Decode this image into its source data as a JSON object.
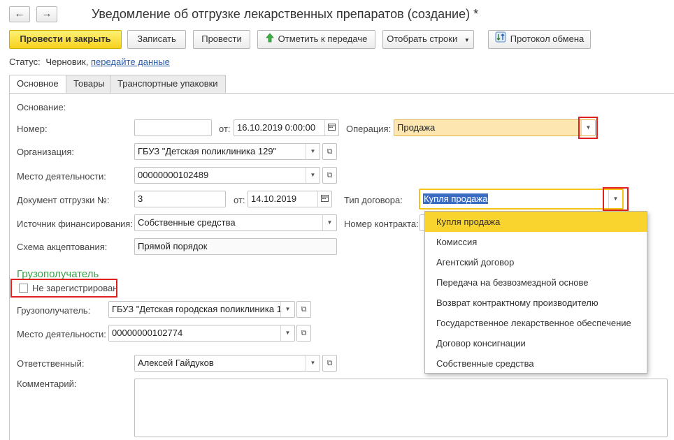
{
  "window": {
    "title": "Уведомление об отгрузке лекарственных препаратов (создание) *",
    "nav": {
      "back": "←",
      "forward": "→"
    }
  },
  "toolbar": {
    "post_close": "Провести и закрыть",
    "save": "Записать",
    "post": "Провести",
    "mark_transfer": "Отметить к передаче",
    "select_rows": "Отобрать строки",
    "exchange_log": "Протокол обмена"
  },
  "status": {
    "label": "Статус:",
    "value": "Черновик,",
    "link": "передайте данные"
  },
  "tabs": [
    "Основное",
    "Товары",
    "Транспортные упаковки"
  ],
  "form": {
    "basis_label": "Основание:",
    "number_label": "Номер:",
    "number_value": "",
    "from_label": "от:",
    "date_value": "16.10.2019  0:00:00",
    "operation_label": "Операция:",
    "operation_value": "Продажа",
    "org_label": "Организация:",
    "org_value": "ГБУЗ \"Детская  поликлиника 129\"",
    "place_label": "Место деятельности:",
    "place_value": "00000000102489",
    "ship_doc_label": "Документ отгрузки №:",
    "ship_doc_value": "3",
    "ship_from_label": "от:",
    "ship_date_value": "14.10.2019",
    "contract_type_label": "Тип договора:",
    "contract_type_value": "Купля продажа",
    "funding_label": "Источник финансирования:",
    "funding_value": "Собственные средства",
    "contract_no_label": "Номер контракта:",
    "scheme_label": "Схема акцептования:",
    "scheme_value": "Прямой порядок",
    "consignee_section": "Грузополучатель",
    "not_registered_label": "Не зарегистрирован",
    "consignee_label": "Грузополучатель:",
    "consignee_value": "ГБУЗ \"Детская городская поликлиника 1",
    "consignee_place_label": "Место деятельности:",
    "consignee_place_value": "00000000102774",
    "responsible_label": "Ответственный:",
    "responsible_value": "Алексей Гайдуков",
    "comment_label": "Комментарий:"
  },
  "dropdown": {
    "items": [
      "Купля продажа",
      "Комиссия",
      "Агентский договор",
      "Передача на безвозмездной основе",
      "Возврат контрактному производителю",
      "Государственное лекарственное обеспечение",
      "Договор консигнации",
      "Собственные средства"
    ],
    "selected_index": 0
  },
  "colors": {
    "accent": "#f9d42e",
    "highlight_red": "#e02020",
    "section_green": "#3aa24a",
    "link": "#2a5ca8"
  }
}
